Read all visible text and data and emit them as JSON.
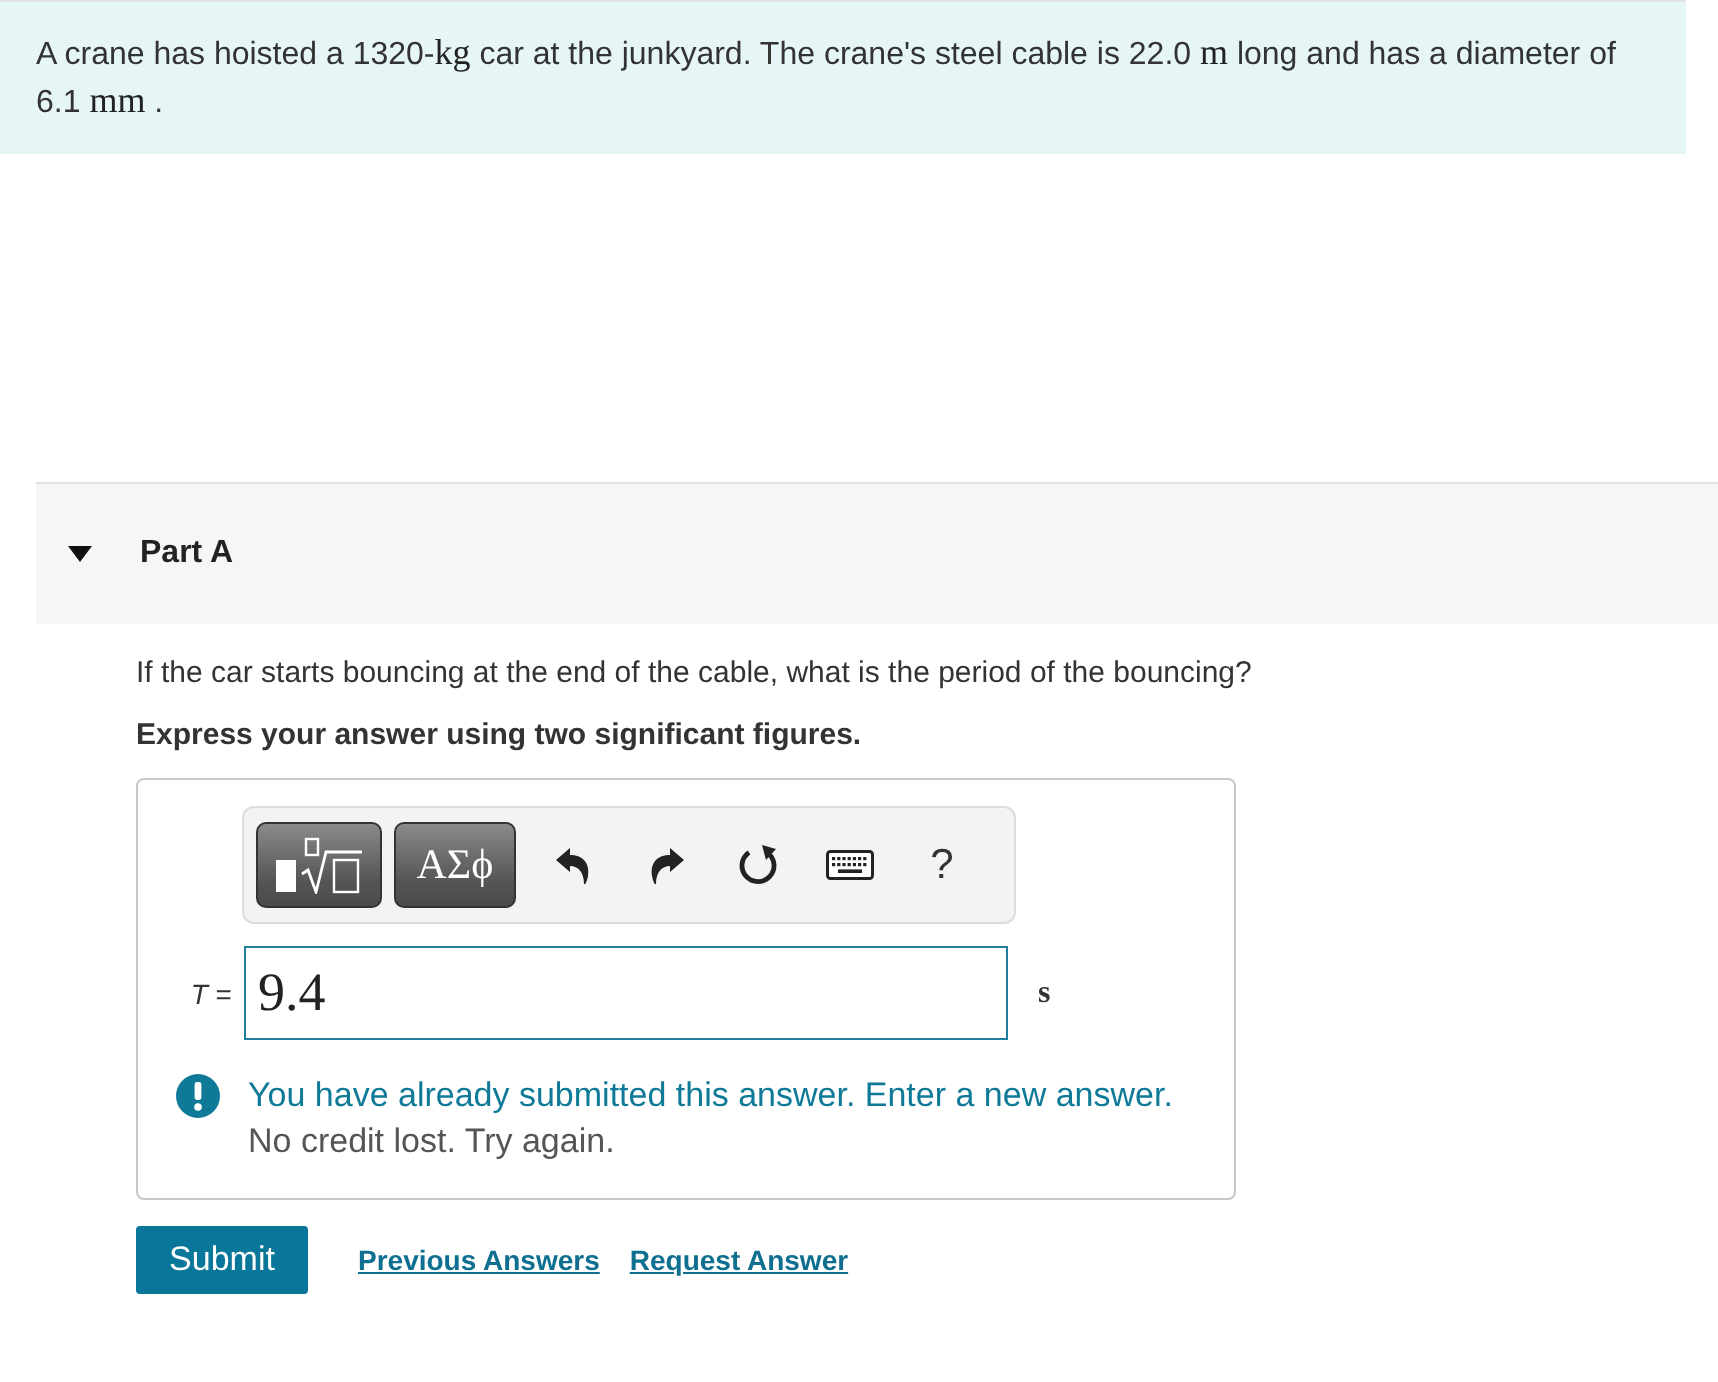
{
  "problem": {
    "statement": [
      {
        "kind": "text",
        "text": "A crane has hoisted a 1320-"
      },
      {
        "kind": "unit",
        "text": "kg"
      },
      {
        "kind": "text",
        "text": " car at the junkyard. The crane's steel cable is 22.0 "
      },
      {
        "kind": "unit",
        "text": "m"
      },
      {
        "kind": "text",
        "text": " long and has a diameter of 6.1 "
      },
      {
        "kind": "unit",
        "text": "mm"
      },
      {
        "kind": "text",
        "text": " ."
      }
    ]
  },
  "part": {
    "label": "Part A",
    "expanded": true,
    "question": "If the car starts bouncing at the end of the cable, what is the period of the bouncing?",
    "instruction": "Express your answer using two significant figures.",
    "toolbar": [
      {
        "kind": "templates"
      },
      {
        "kind": "symbols",
        "label": "ΑΣϕ"
      },
      {
        "kind": "undo"
      },
      {
        "kind": "redo"
      },
      {
        "kind": "reset"
      },
      {
        "kind": "keyboard"
      },
      {
        "kind": "help",
        "label": "?"
      }
    ],
    "answer": {
      "label": "*T* =",
      "value": "9.4",
      "unit": "s"
    },
    "feedback": {
      "message": "You have already submitted this answer. Enter a new answer.",
      "detail": "No credit lost. Try again."
    },
    "actions": [
      {
        "kind": "submit",
        "label": "Submit"
      },
      {
        "kind": "link",
        "label": "Previous Answers"
      },
      {
        "kind": "link",
        "label": "Request Answer"
      }
    ]
  }
}
